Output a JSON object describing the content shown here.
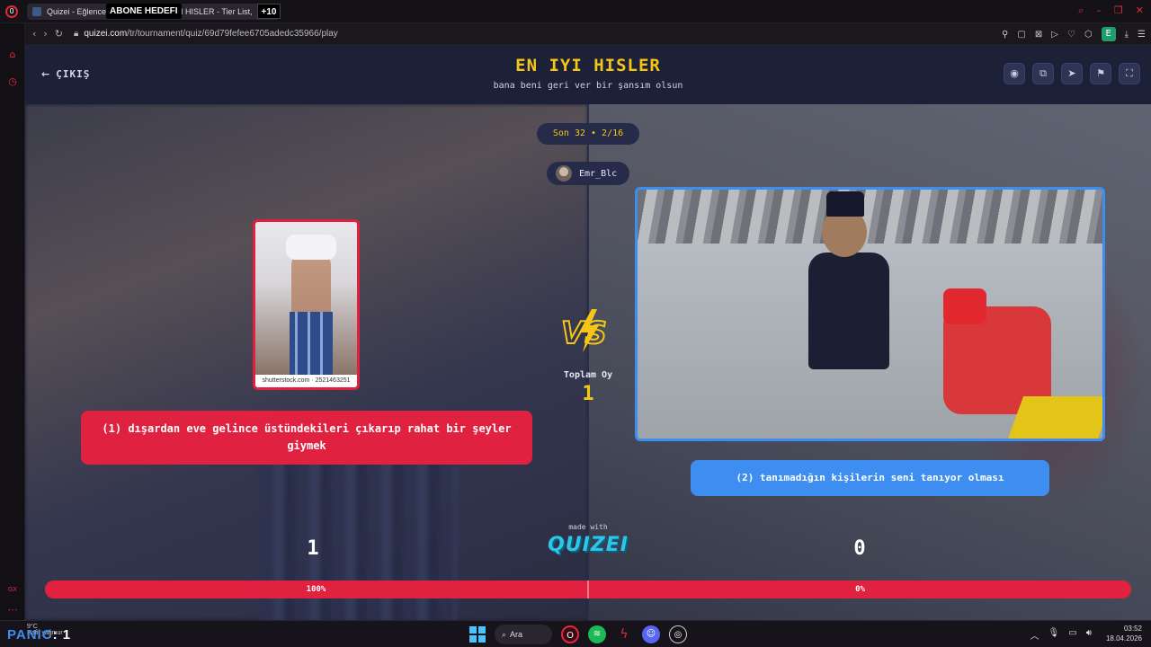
{
  "browser": {
    "tab_title": "Quizei - Eğlenceli v",
    "tab_title_tail": "YI HISLER - Tier List, ",
    "overlay_abone": "ABONE HEDEFI",
    "overlay_count": "+10",
    "url_domain": "quizei.com",
    "url_path": "/tr/tournament/quiz/69d79fefee6705adedc35966/play"
  },
  "header": {
    "exit_label": "ÇIKIŞ",
    "title": "EN IYI HISLER",
    "subtitle": "bana beni geri ver bir şansım olsun"
  },
  "round": {
    "label": "Son 32 • 2/16"
  },
  "user": {
    "name": "Emr_Blc"
  },
  "left": {
    "image_credit": "shutterstock.com · 2521463251",
    "option_text": "(1) dışardan eve gelince üstündekileri çıkarıp rahat bir şeyler giymek",
    "votes": "1",
    "percent_label": "100%",
    "percent": 100
  },
  "right": {
    "option_text": "(2) tanımadığın kişilerin seni tanıyor olması",
    "votes": "0",
    "percent_label": "0%",
    "percent": 0
  },
  "total": {
    "label": "Toplam Oy",
    "value": "1"
  },
  "branding": {
    "made_with": "made with",
    "logo": "QUIZEI"
  },
  "taskbar": {
    "weather_temp": "9°C",
    "weather_desc": "Hafif yağmur",
    "overlay_text": "PANIC",
    "overlay_suffix": ": 1",
    "search_label": "Ara",
    "time": "03:52",
    "date": "18.04.2026"
  },
  "colors": {
    "accent_yellow": "#f5c518",
    "left_red": "#e0213f",
    "right_blue": "#3d8ef0",
    "header_bg": "#1d2138"
  }
}
